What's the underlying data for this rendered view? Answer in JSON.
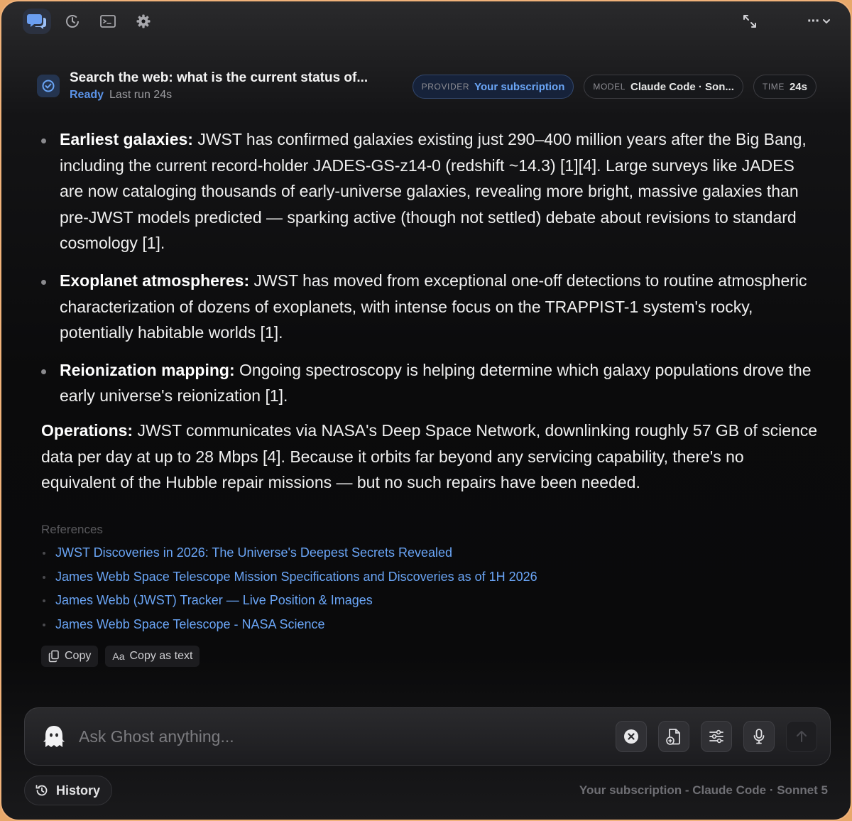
{
  "toolbar": {
    "icons": [
      "chat-bubbles-icon",
      "history-clock-icon",
      "terminal-icon",
      "gear-icon"
    ],
    "right_icons": [
      "expand-icon",
      "more-options-icon"
    ],
    "more_label": "···"
  },
  "header": {
    "title": "Search the web: what is the current status of...",
    "status": "Ready",
    "last_run": "Last run 24s",
    "provider_key": "PROVIDER",
    "provider_value": "Your subscription",
    "model_key": "MODEL",
    "model_value": "Claude Code · Son...",
    "time_key": "TIME",
    "time_value": "24s"
  },
  "content": {
    "bullets": [
      {
        "bold": "Earliest galaxies:",
        "text": " JWST has confirmed galaxies existing just 290–400 million years after the Big Bang, including the current record-holder JADES-GS-z14-0 (redshift ~14.3) [1][4]. Large surveys like JADES are now cataloging thousands of early-universe galaxies, revealing more bright, massive galaxies than pre-JWST models predicted — sparking active (though not settled) debate about revisions to standard cosmology [1]."
      },
      {
        "bold": "Exoplanet atmospheres:",
        "text": " JWST has moved from exceptional one-off detections to routine atmospheric characterization of dozens of exoplanets, with intense focus on the TRAPPIST-1 system's rocky, potentially habitable worlds [1]."
      },
      {
        "bold": "Reionization mapping:",
        "text": " Ongoing spectroscopy is helping determine which galaxy populations drove the early universe's reionization [1]."
      }
    ],
    "operations_bold": "Operations:",
    "operations_text": " JWST communicates via NASA's Deep Space Network, downlinking roughly 57 GB of science data per day at up to 28 Mbps [4]. Because it orbits far beyond any servicing capability, there's no equivalent of the Hubble repair missions — but no such repairs have been needed.",
    "references_title": "References",
    "references": [
      "JWST Discoveries in 2026: The Universe's Deepest Secrets Revealed",
      "James Webb Space Telescope Mission Specifications and Discoveries as of 1H 2026",
      "James Webb (JWST) Tracker — Live Position & Images",
      "James Webb Space Telescope - NASA Science"
    ],
    "copy_label": "Copy",
    "copy_text_prefix": "Aa",
    "copy_text_label": "Copy as text"
  },
  "input": {
    "placeholder": "Ask Ghost anything...",
    "value": ""
  },
  "footer": {
    "history_label": "History",
    "status": "Your subscription - Claude Code · Sonnet 5"
  },
  "colors": {
    "accent": "#6aa5f6",
    "ready": "#5b93e8",
    "frame": "#f0b27a",
    "background": "#0b0b0c"
  }
}
